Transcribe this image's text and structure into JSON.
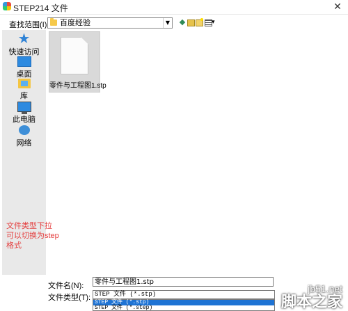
{
  "window": {
    "title": "STEP214 文件"
  },
  "lookin": {
    "label": "查找范围(I):",
    "value": "百度经验"
  },
  "places": [
    {
      "label": "快速访问",
      "icon": "star-icon"
    },
    {
      "label": "桌面",
      "icon": "desktop-icon"
    },
    {
      "label": "库",
      "icon": "library-icon"
    },
    {
      "label": "此电脑",
      "icon": "computer-icon"
    },
    {
      "label": "网络",
      "icon": "network-icon"
    }
  ],
  "files": [
    {
      "name": "零件与工程图1.stp",
      "icon": "document-icon"
    }
  ],
  "annotation": {
    "lines": [
      "文件类型下拉",
      "可以切换为step",
      "格式"
    ],
    "color": "#e43d3d"
  },
  "filename": {
    "label": "文件名(N):",
    "value": "零件与工程图1.stp"
  },
  "filetype": {
    "label": "文件类型(T):",
    "value": "STEP 文件 (*.stp)",
    "options": [
      "STEP 文件 (*.stp)",
      "STEP 文件 (*.step)"
    ],
    "selected_index": 0
  },
  "watermark": {
    "url": "jb51.net",
    "brand": "脚本之家"
  }
}
